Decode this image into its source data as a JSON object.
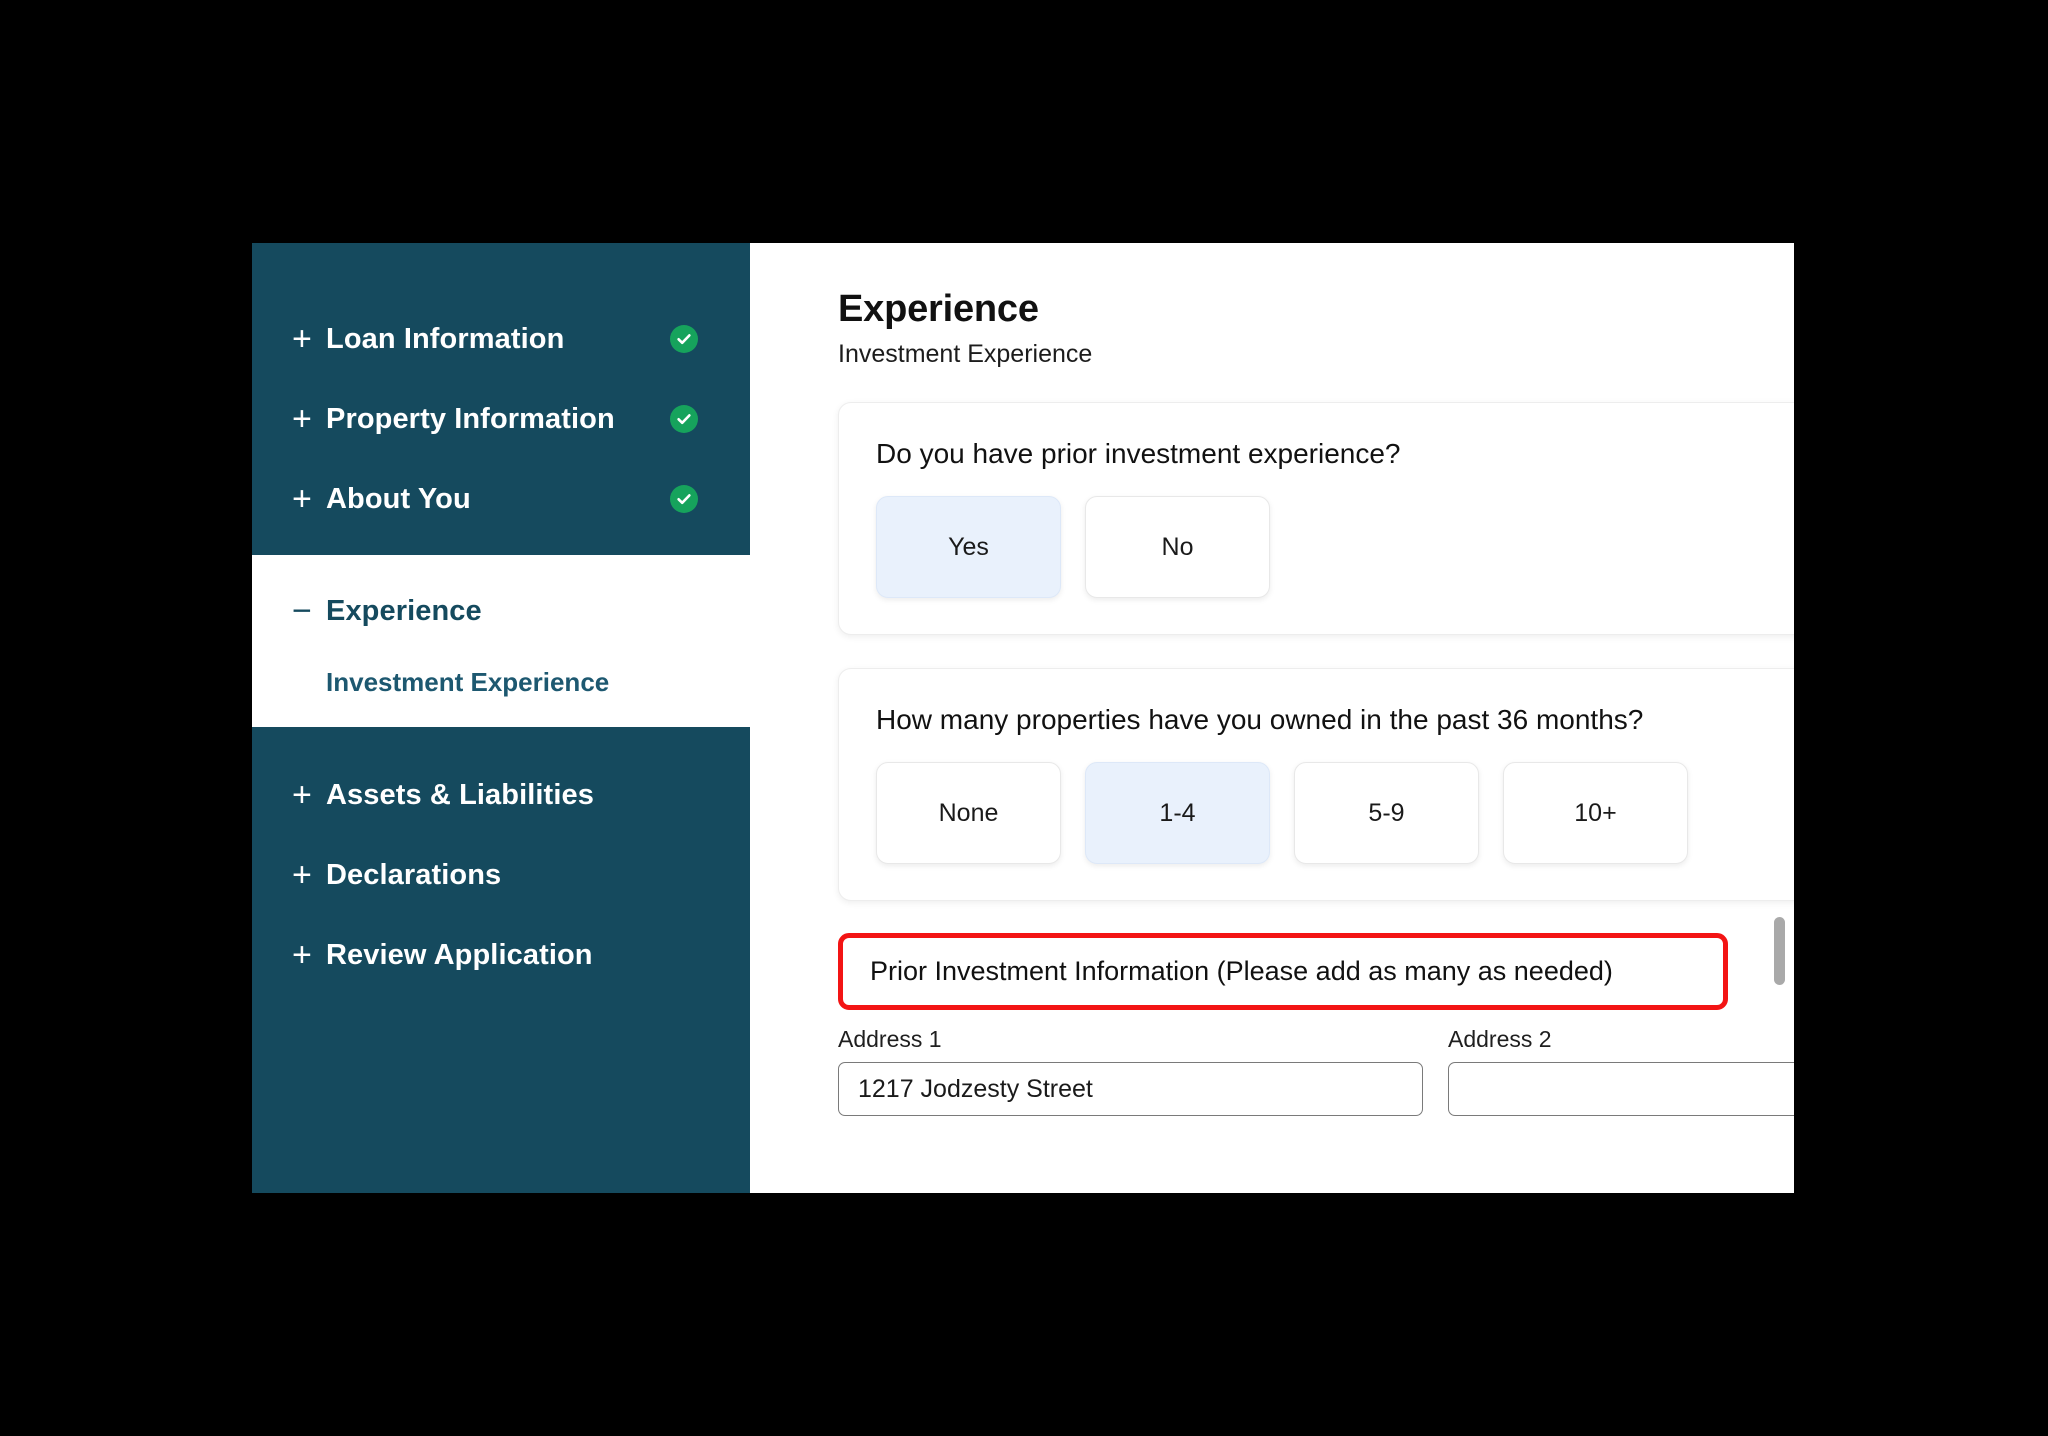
{
  "sidebar": {
    "groups": [
      {
        "items": [
          {
            "label": "Loan Information",
            "toggle_icon": "plus-icon",
            "complete": true
          },
          {
            "label": "Property Information",
            "toggle_icon": "plus-icon",
            "complete": true
          },
          {
            "label": "About You",
            "toggle_icon": "plus-icon",
            "complete": true
          }
        ]
      }
    ],
    "active_group": {
      "label": "Experience",
      "toggle_icon": "minus-icon",
      "subitems": [
        {
          "label": "Investment Experience",
          "active": true
        }
      ]
    },
    "lower_items": [
      {
        "label": "Assets & Liabilities",
        "toggle_icon": "plus-icon"
      },
      {
        "label": "Declarations",
        "toggle_icon": "plus-icon"
      },
      {
        "label": "Review Application",
        "toggle_icon": "plus-icon"
      }
    ],
    "colors": {
      "background": "#154a5e",
      "active_background": "#ffffff",
      "active_text": "#154a5e",
      "check_badge": "#16a35c"
    }
  },
  "main": {
    "title": "Experience",
    "subtitle": "Investment Experience",
    "questions": [
      {
        "text": "Do you have prior investment experience?",
        "options": [
          {
            "label": "Yes",
            "selected": true
          },
          {
            "label": "No",
            "selected": false
          }
        ]
      },
      {
        "text": "How many properties have you owned in the past 36 months?",
        "options": [
          {
            "label": "None",
            "selected": false
          },
          {
            "label": "1-4",
            "selected": true
          },
          {
            "label": "5-9",
            "selected": false
          },
          {
            "label": "10+",
            "selected": false
          }
        ]
      }
    ],
    "prior_investment": {
      "heading": "Prior Investment Information (Please add as many as needed)",
      "highlight_color": "#f31414",
      "fields": [
        {
          "label": "Address 1",
          "value": "1217 Jodzesty Street",
          "placeholder": ""
        },
        {
          "label": "Address 2",
          "value": "",
          "placeholder": ""
        }
      ]
    }
  },
  "caption": {
    "lines": [
      "",
      "",
      "",
      ""
    ]
  }
}
